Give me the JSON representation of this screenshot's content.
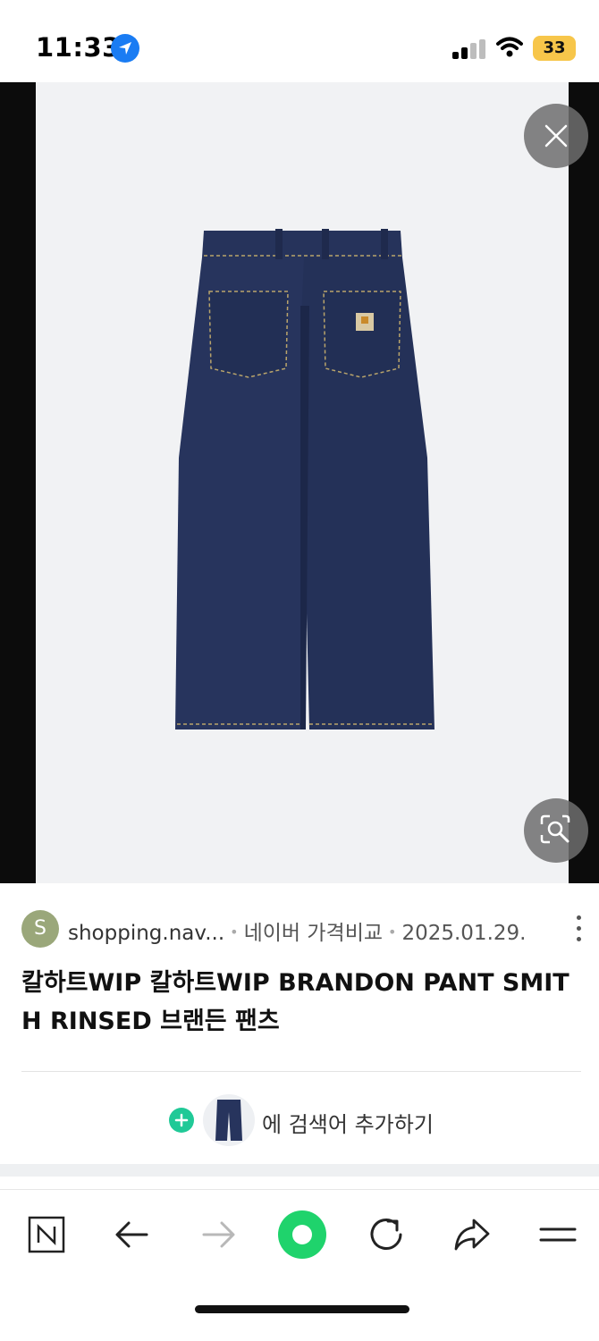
{
  "status_bar": {
    "time": "11:33",
    "battery": "33"
  },
  "viewer": {
    "close_icon": "close-icon",
    "lens_icon": "image-search-icon",
    "image_subject": "pants-image"
  },
  "source": {
    "avatar_letter": "S",
    "site": "shopping.nav...",
    "service": "네이버 가격비교",
    "date": "2025.01.29."
  },
  "product": {
    "title": "칼하트WIP 칼하트WIP BRANDON PANT SMITH RINSED 브랜든 팬츠"
  },
  "add_search": {
    "label": "에 검색어 추가하기"
  },
  "toolbar": {
    "items": [
      "naver-home-icon",
      "back-arrow-icon",
      "forward-arrow-icon",
      "green-dot-icon",
      "reload-icon",
      "share-icon",
      "menu-icon"
    ]
  },
  "colors": {
    "accent_green": "#20c997",
    "location_blue": "#1a7cf3",
    "battery_yellow": "#f7c64a",
    "denim": "#25325a"
  }
}
